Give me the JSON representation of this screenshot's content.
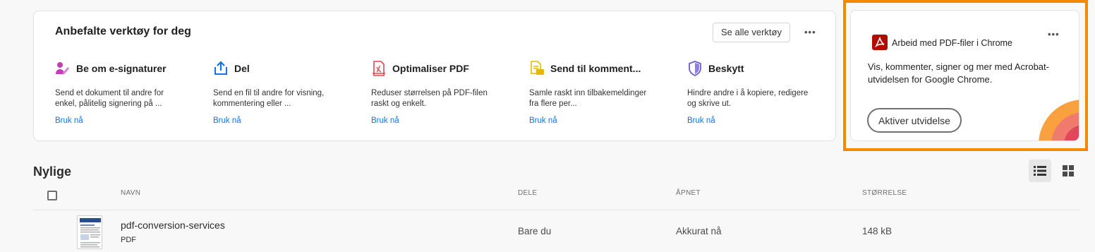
{
  "tools": {
    "title": "Anbefalte verktøy for deg",
    "see_all_label": "Se alle verktøy",
    "more_label": "•••",
    "items": [
      {
        "name": "Be om e-signaturer",
        "icon": "e-sign-icon",
        "desc": "Send et dokument til andre for enkel, pålitelig signering på ...",
        "link": "Bruk nå"
      },
      {
        "name": "Del",
        "icon": "share-icon",
        "desc": "Send en fil til andre for visning, kommentering eller ...",
        "link": "Bruk nå"
      },
      {
        "name": "Optimaliser PDF",
        "icon": "optimize-pdf-icon",
        "desc": "Reduser størrelsen på PDF-filen raskt og enkelt.",
        "link": "Bruk nå"
      },
      {
        "name": "Send til komment...",
        "icon": "send-for-comment-icon",
        "desc": "Samle raskt inn tilbakemeldinger fra flere per...",
        "link": "Bruk nå"
      },
      {
        "name": "Beskytt",
        "icon": "protect-shield-icon",
        "desc": "Hindre andre i å kopiere, redigere og skrive ut.",
        "link": "Bruk nå"
      }
    ]
  },
  "promo": {
    "title": "Arbeid med PDF-filer i Chrome",
    "desc": "Vis, kommenter, signer og mer med Acrobat-utvidelsen for Google Chrome.",
    "button": "Aktiver utvidelse",
    "more_label": "•••",
    "icon": "acrobat-icon"
  },
  "recent": {
    "title": "Nylige",
    "columns": {
      "name": "NAVN",
      "share": "DELE",
      "opened": "ÅPNET",
      "size": "STØRRELSE"
    },
    "files": [
      {
        "name": "pdf-conversion-services",
        "type": "PDF",
        "share": "Bare du",
        "opened": "Akkurat nå",
        "size": "148 kB"
      }
    ]
  },
  "colors": {
    "accent": "#1473e6",
    "highlight": "#f28a00",
    "acrobat_red": "#b30b00"
  }
}
